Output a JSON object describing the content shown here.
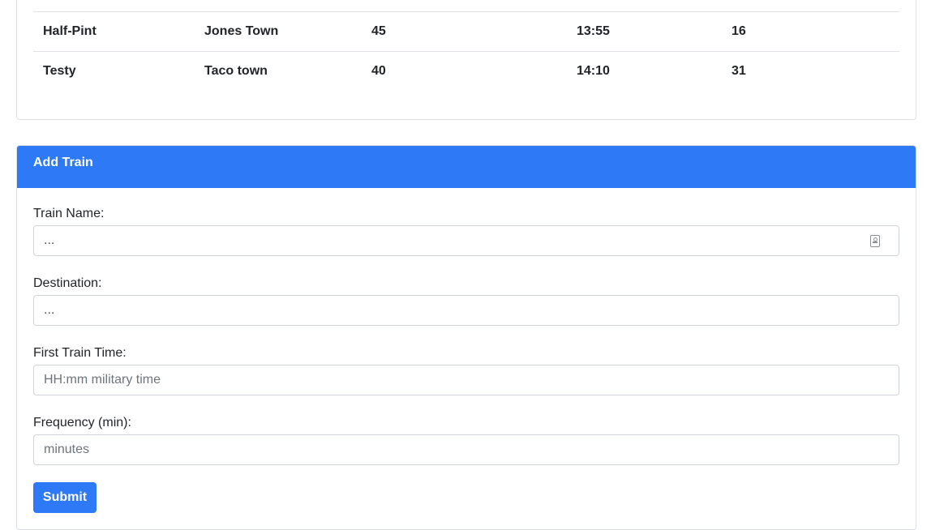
{
  "schedule": {
    "rows": [
      [
        "Half-Pint",
        "Jones Town",
        "45",
        "13:55",
        "16"
      ],
      [
        "Testy",
        "Taco town",
        "40",
        "14:10",
        "31"
      ]
    ]
  },
  "add_train": {
    "header": "Add Train",
    "fields": {
      "name": {
        "label": "Train Name:",
        "value": "..."
      },
      "destination": {
        "label": "Destination:",
        "value": "..."
      },
      "first_time": {
        "label": "First Train Time:",
        "placeholder": "HH:mm military time"
      },
      "frequency": {
        "label": "Frequency (min):",
        "placeholder": "minutes"
      }
    },
    "submit_label": "Submit"
  },
  "colors": {
    "primary": "#2e79f6",
    "border": "#dcdfe3"
  },
  "icons": {
    "autofill": "contact-card-icon"
  }
}
